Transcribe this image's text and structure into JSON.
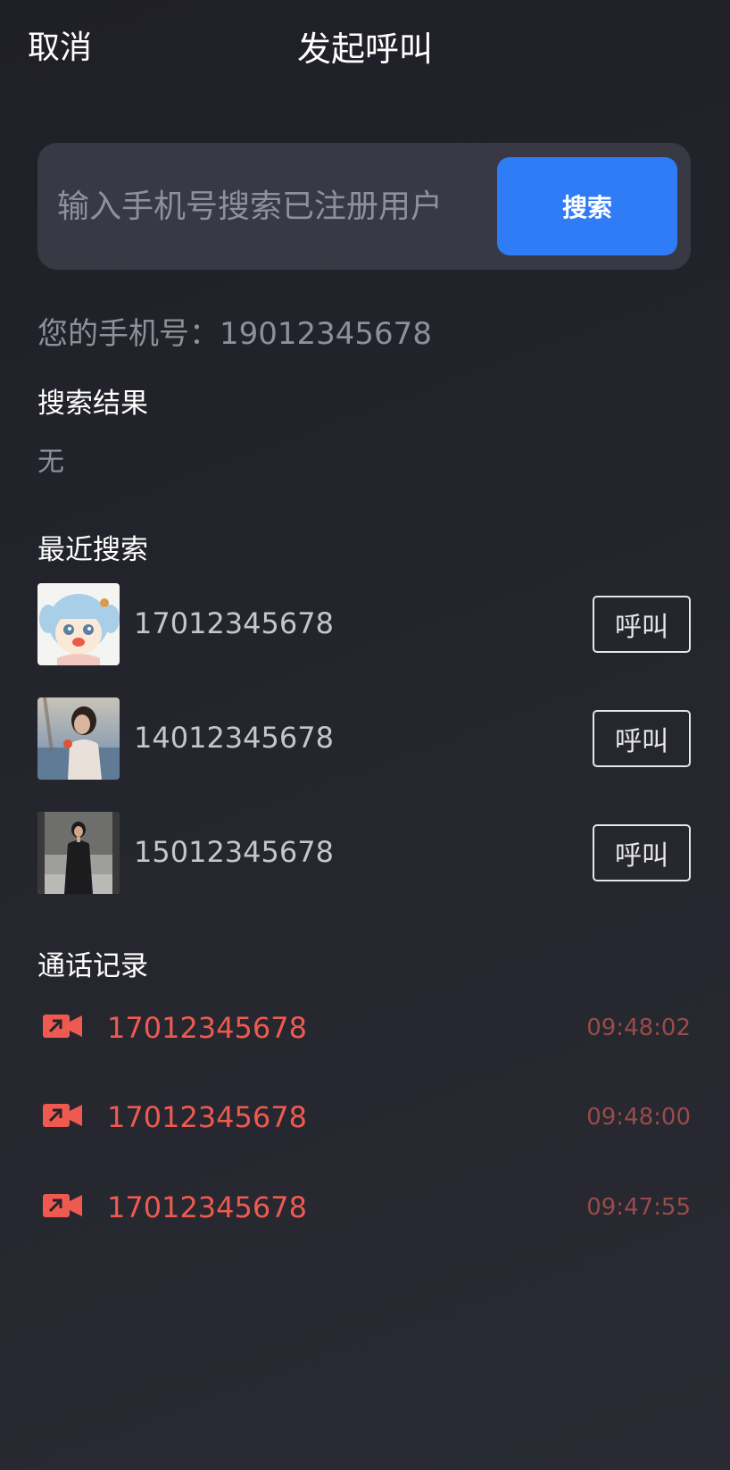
{
  "header": {
    "cancel_label": "取消",
    "title": "发起呼叫"
  },
  "search": {
    "placeholder": "输入手机号搜索已注册用户",
    "value": "",
    "button_label": "搜索"
  },
  "my_phone": "您的手机号：19012345678",
  "results": {
    "title": "搜索结果",
    "empty_text": "无"
  },
  "recent": {
    "title": "最近搜索",
    "items": [
      {
        "number": "17012345678",
        "call_label": "呼叫",
        "avatar": "anime-girl-avatar"
      },
      {
        "number": "14012345678",
        "call_label": "呼叫",
        "avatar": "photo-woman-avatar"
      },
      {
        "number": "15012345678",
        "call_label": "呼叫",
        "avatar": "photo-woman-dark-dress-avatar"
      }
    ]
  },
  "call_log": {
    "title": "通话记录",
    "items": [
      {
        "number": "17012345678",
        "time": "09:48:02",
        "icon": "outgoing-video-call-icon"
      },
      {
        "number": "17012345678",
        "time": "09:48:00",
        "icon": "outgoing-video-call-icon"
      },
      {
        "number": "17012345678",
        "time": "09:47:55",
        "icon": "outgoing-video-call-icon"
      }
    ]
  },
  "colors": {
    "background": "#24252d",
    "search_box": "#383944",
    "accent_blue": "#2f7cf6",
    "log_red": "#ef5a50",
    "log_time": "#9a4b49"
  }
}
